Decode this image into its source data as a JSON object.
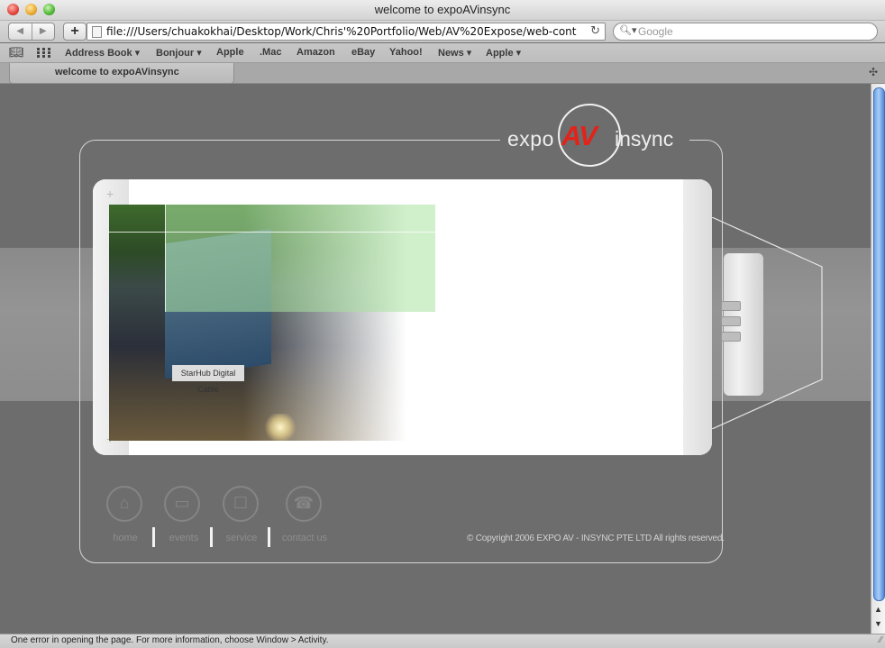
{
  "window": {
    "title": "welcome to expoAVinsync"
  },
  "toolbar": {
    "back_icon": "back-arrow-icon",
    "forward_icon": "forward-arrow-icon",
    "add_label": "+",
    "url": "file:///Users/chuakokhai/Desktop/Work/Chris'%20Portfolio/Web/AV%20Expose/web-cont",
    "reload_icon": "reload-icon",
    "search_placeholder": "Google"
  },
  "bookmarks": [
    {
      "label": "Address Book ▾"
    },
    {
      "label": "Bonjour ▾"
    },
    {
      "label": "Apple"
    },
    {
      "label": ".Mac"
    },
    {
      "label": "Amazon"
    },
    {
      "label": "eBay"
    },
    {
      "label": "Yahoo!"
    },
    {
      "label": "News ▾"
    },
    {
      "label": "Apple ▾"
    }
  ],
  "tabs": [
    {
      "label": "welcome to expoAVinsync"
    }
  ],
  "site": {
    "logo": {
      "expo": "expo",
      "av": "AV",
      "insync": "insync"
    },
    "photo_banner": "StarHub Digital Cable",
    "nav": [
      {
        "label": "home",
        "icon": "house-icon"
      },
      {
        "label": "events",
        "icon": "folder-icon"
      },
      {
        "label": "service",
        "icon": "clipboard-icon"
      },
      {
        "label": "contact us",
        "icon": "telephone-icon"
      }
    ],
    "copyright": "© Copyright 2006 EXPO AV - INSYNC PTE  LTD All rights reserved."
  },
  "status": {
    "text": "One error in opening the page. For more information, choose Window > Activity."
  },
  "colors": {
    "accent_red": "#e2231a",
    "scroll_blue": "#6aa0e6"
  }
}
